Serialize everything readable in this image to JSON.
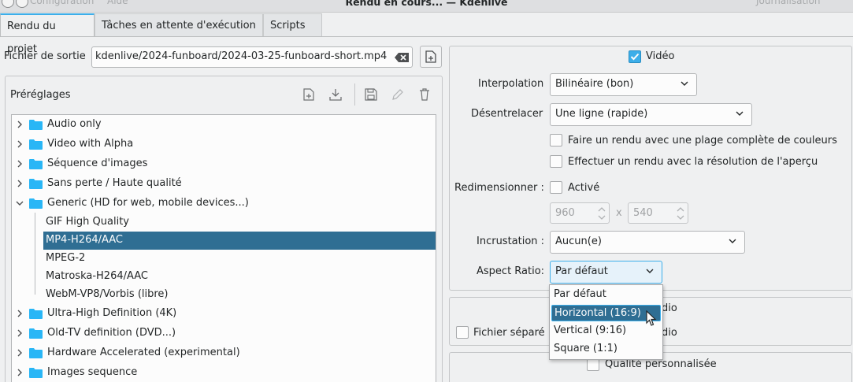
{
  "window": {
    "title": "Rendu en cours... — Kdenlive",
    "menu_ghost_left": "Configuration",
    "menu_ghost_help": "Aide",
    "menu_ghost_right": "Journalisation"
  },
  "tabs": [
    {
      "label": "Rendu du projet",
      "active": true
    },
    {
      "label": "Tâches en attente d'exécution",
      "active": false
    },
    {
      "label": "Scripts",
      "active": false
    }
  ],
  "output": {
    "label": "Fichier de sortie",
    "value": "kdenlive/2024-funboard/2024-03-25-funboard-short.mp4"
  },
  "presets": {
    "title": "Préréglages",
    "items": [
      {
        "label": "Audio only",
        "type": "folder",
        "expanded": false
      },
      {
        "label": "Video with Alpha",
        "type": "folder",
        "expanded": false
      },
      {
        "label": "Séquence d'images",
        "type": "folder",
        "expanded": false
      },
      {
        "label": "Sans perte / Haute qualité",
        "type": "folder",
        "expanded": false
      },
      {
        "label": "Generic (HD for web, mobile devices...)",
        "type": "folder",
        "expanded": true
      },
      {
        "label": "GIF High Quality",
        "type": "child"
      },
      {
        "label": "MP4-H264/AAC",
        "type": "child",
        "selected": true
      },
      {
        "label": "MPEG-2",
        "type": "child"
      },
      {
        "label": "Matroska-H264/AAC",
        "type": "child"
      },
      {
        "label": "WebM-VP8/Vorbis (libre)",
        "type": "child"
      },
      {
        "label": "Ultra-High Definition (4K)",
        "type": "folder",
        "expanded": false
      },
      {
        "label": "Old-TV definition (DVD...)",
        "type": "folder",
        "expanded": false
      },
      {
        "label": "Hardware Accelerated (experimental)",
        "type": "folder",
        "expanded": false
      },
      {
        "label": "Images sequence",
        "type": "folder",
        "expanded": false
      }
    ]
  },
  "video": {
    "enabled_label": "Vidéo",
    "interpolation_label": "Interpolation",
    "interpolation_value": "Bilinéaire (bon)",
    "deinterlace_label": "Désentrelacer",
    "deinterlace_value": "Une ligne (rapide)",
    "full_range_label": "Faire un rendu avec une plage complète de couleurs",
    "preview_res_label": "Effectuer un rendu avec la résolution de l'aperçu",
    "resize_label": "Redimensionner :",
    "resize_active_label": "Activé",
    "width_value": "960",
    "times_label": "x",
    "height_value": "540",
    "overlay_label": "Incrustation :",
    "overlay_value": "Aucun(e)",
    "aspect_label": "Aspect Ratio:",
    "aspect_value": "Par défaut",
    "aspect_options": [
      "Par défaut",
      "Horizontal (16:9)",
      "Vertical (9:16)",
      "Square (1:1)"
    ],
    "aspect_highlighted": 1
  },
  "audio": {
    "enabled_fragment": "dio",
    "separate_label": "Fichier séparé",
    "separate_fragment": "dio"
  },
  "quality": {
    "custom_label": "Qualité personnalisée"
  },
  "colors": {
    "accent": "#3daee9",
    "selection": "#2f6e93",
    "folder": "#29b6f6"
  }
}
